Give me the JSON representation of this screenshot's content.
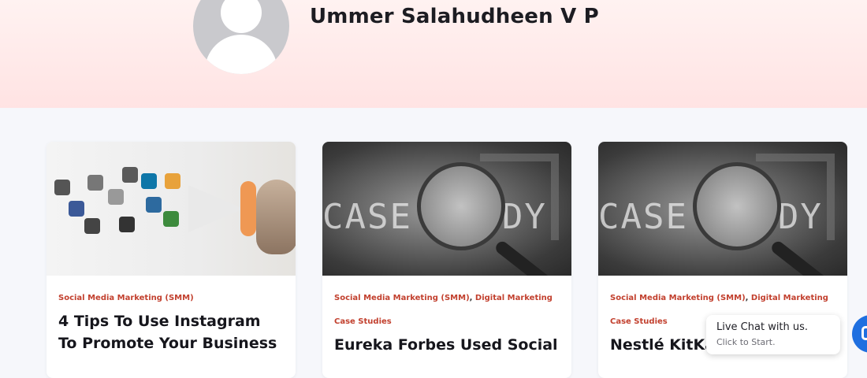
{
  "author": {
    "name": "Ummer Salahudheen V P"
  },
  "posts": [
    {
      "categories": [
        "Social Media Marketing (SMM)"
      ],
      "title": "4 Tips To Use Instagram To Promote Your Business"
    },
    {
      "categories": [
        "Social Media Marketing (SMM)",
        "Digital Marketing Case Studies"
      ],
      "thumb_text": "CASE STUDY",
      "title": "Eureka Forbes Used Social"
    },
    {
      "categories": [
        "Social Media Marketing (SMM)",
        "Digital Marketing Case Studies"
      ],
      "thumb_text": "CASE STUDY",
      "title": "Nestlé KitKat"
    }
  ],
  "chat": {
    "title": "Live Chat with us.",
    "subtitle": "Click to Start."
  },
  "colors": {
    "accent": "#c2402e",
    "hero_bg": "#ffe3e3",
    "chat_blue": "#1f6fe0"
  }
}
